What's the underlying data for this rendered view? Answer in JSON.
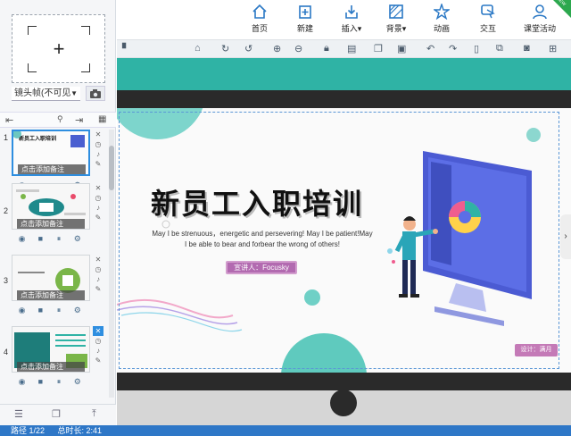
{
  "toolbar": {
    "items": [
      {
        "label": "首页",
        "icon": "home-icon"
      },
      {
        "label": "新建",
        "icon": "new-icon"
      },
      {
        "label": "插入▾",
        "icon": "insert-icon"
      },
      {
        "label": "背景▾",
        "icon": "background-icon"
      },
      {
        "label": "动画",
        "icon": "animation-icon"
      },
      {
        "label": "交互",
        "icon": "interaction-icon"
      },
      {
        "label": "课堂活动",
        "icon": "classroom-icon"
      }
    ],
    "badge": "NEW"
  },
  "left_panel": {
    "new_frame_symbol": "+",
    "camera_select": "镜头帧(不可见",
    "slides": [
      {
        "number": "1",
        "caption": "点击添加备注"
      },
      {
        "number": "2",
        "caption": "点击添加备注"
      },
      {
        "number": "3",
        "caption": "点击添加备注"
      },
      {
        "number": "4",
        "caption": "点击添加备注"
      }
    ]
  },
  "slide": {
    "title": "新员工入职培训",
    "subtitle": "May I be strenuous，energetic and persevering! May I be patient!May I be able to bear and forbear the wrong of others!",
    "lecturer": "宣讲人：Focusky",
    "designer": "设计：满月"
  },
  "status": {
    "path": "路径 1/22",
    "total_time": "总时长: 2:41"
  },
  "colors": {
    "accent": "#2e77c7",
    "teal": "#2fb3a5",
    "purple": "#b26ab0"
  }
}
